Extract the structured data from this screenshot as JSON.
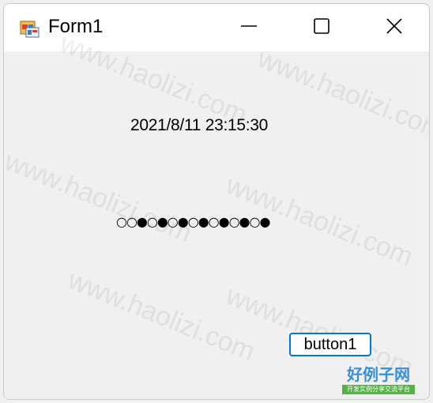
{
  "window": {
    "title": "Form1",
    "icon": "winforms-app-icon",
    "controls": {
      "minimize": "minimize-icon",
      "maximize": "maximize-icon",
      "close": "close-icon"
    }
  },
  "form": {
    "time_label": "2021/8/11 23:15:30",
    "dots_label": "○○●○●○●○●○●○●○●",
    "button1_label": "button1"
  },
  "watermark": {
    "text": "www.haolizi.com",
    "brand": "好例子网",
    "brand_sub": "开发实例分享交流平台"
  },
  "colors": {
    "button_border": "#0078d7",
    "client_bg": "#f0f0f0",
    "titlebar_bg": "#ffffff"
  }
}
